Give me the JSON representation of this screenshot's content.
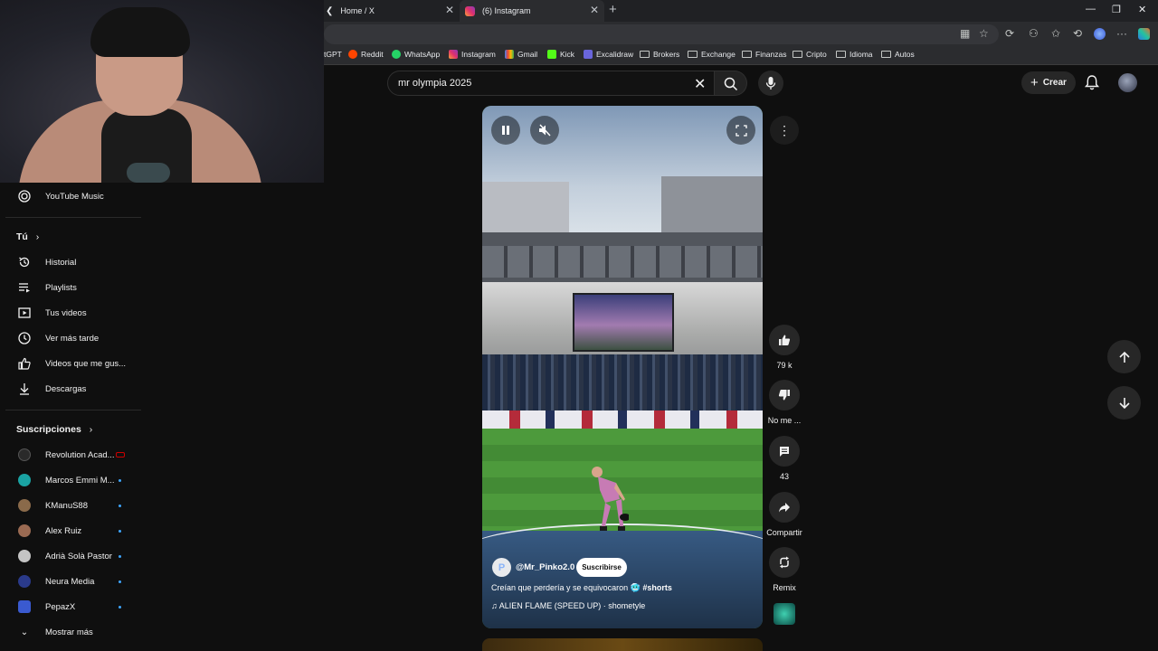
{
  "browser": {
    "tabs": [
      {
        "label": "Home / X"
      },
      {
        "label": "(6) Instagram"
      }
    ],
    "bookmarks": [
      "tGPT",
      "Reddit",
      "WhatsApp",
      "Instagram",
      "Gmail",
      "Kick",
      "Excalidraw",
      "Brokers",
      "Exchange",
      "Finanzas",
      "Cripto",
      "Idioma",
      "Autos"
    ]
  },
  "header": {
    "search_value": "mr olympia 2025",
    "create_label": "Crear"
  },
  "sidebar": {
    "youtube_music": "YouTube Music",
    "you_heading": "Tú",
    "you_items": [
      {
        "label": "Historial",
        "icon": "history-icon"
      },
      {
        "label": "Playlists",
        "icon": "playlist-icon"
      },
      {
        "label": "Tus videos",
        "icon": "video-icon"
      },
      {
        "label": "Ver más tarde",
        "icon": "clock-icon"
      },
      {
        "label": "Videos que me gus...",
        "icon": "thumb-up-icon"
      },
      {
        "label": "Descargas",
        "icon": "download-icon"
      }
    ],
    "subs_heading": "Suscripciones",
    "subscriptions": [
      {
        "label": "Revolution Acad...",
        "color": "#2a2a2a",
        "status": "live"
      },
      {
        "label": "Marcos Emmi M...",
        "color": "#1aa3a3",
        "status": "new"
      },
      {
        "label": "KManuS88",
        "color": "#8a6a4a",
        "status": "new"
      },
      {
        "label": "Alex Ruiz",
        "color": "#9a6a52",
        "status": "new"
      },
      {
        "label": "Adrià Solà Pastor",
        "color": "#c4c4c4",
        "status": "new"
      },
      {
        "label": "Neura Media",
        "color": "#2a3a8a",
        "status": "new"
      },
      {
        "label": "PepazX",
        "color": "#3a5ad0",
        "status": "new"
      }
    ],
    "show_more": "Mostrar más"
  },
  "short": {
    "channel": "@Mr_Pinko2.0",
    "channel_initial": "P",
    "subscribe_label": "Suscribirse",
    "title": "Creían que perdería y se equivocaron 🥶",
    "hashtag": "#shorts",
    "sound": "ALIEN FLAME (SPEED UP) · shometyle"
  },
  "actions": {
    "likes": "79 k",
    "dislike": "No me ...",
    "comments": "43",
    "share": "Compartir",
    "remix": "Remix"
  },
  "colors": {
    "background": "#0f0f0f",
    "accent_blue": "#3ea6ff",
    "chip": "#272727"
  }
}
